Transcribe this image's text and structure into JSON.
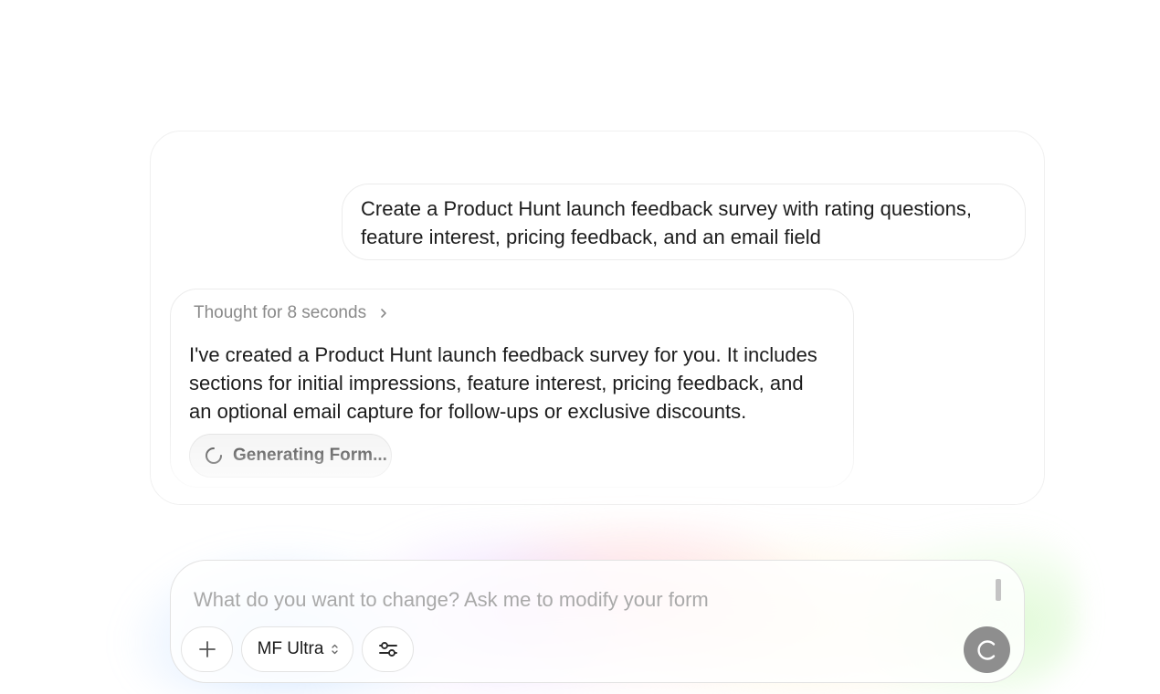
{
  "conversation": {
    "user_message": "Create a Product Hunt launch feedback survey with rating questions, feature interest, pricing feedback, and an email field",
    "assistant": {
      "thought_label": "Thought for 8 seconds",
      "message": "I've created a Product Hunt launch feedback survey for you. It includes sections for initial impressions, feature interest, pricing feedback, and an optional email capture for follow-ups or exclusive discounts.",
      "status_label": "Generating Form..."
    }
  },
  "composer": {
    "placeholder": "What do you want to change? Ask me to modify your form",
    "value": "",
    "model_label": "MF Ultra",
    "icons": {
      "add": "plus-icon",
      "model": "chevron-up-down-icon",
      "settings": "sliders-icon",
      "send": "loading-spinner-icon"
    }
  },
  "colors": {
    "send_button": "#8e8e8e",
    "status_pill": "#f3f3f3",
    "muted_text": "#8a8a8a"
  }
}
